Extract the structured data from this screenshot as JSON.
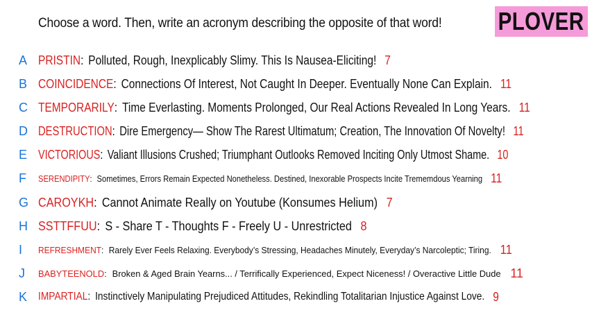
{
  "instruction": "Choose a word. Then, write an acronym describing the opposite of that word!",
  "logo": "PLOVER",
  "colors": {
    "letter": "#1a73d9",
    "word": "#d92121",
    "logo_bg": "#f59bd9"
  },
  "rows": [
    {
      "letter": "A",
      "word": "PRISTIN",
      "text": "Polluted, Rough, Inexplicably Slimy. This Is Nausea-Eliciting!",
      "count": "7"
    },
    {
      "letter": "B",
      "word": "COINCIDENCE",
      "text": "Connections Of Interest, Not Caught In Deeper. Eventually None Can Explain.",
      "count": "11"
    },
    {
      "letter": "C",
      "word": "TEMPORARILY",
      "text": "Time Everlasting. Moments Prolonged, Our Real Actions Revealed In Long Years.",
      "count": "11"
    },
    {
      "letter": "D",
      "word": "DESTRUCTION",
      "text": "Dire Emergency— Show The Rarest Ultimatum; Creation, The Innovation Of Novelty!",
      "count": "11"
    },
    {
      "letter": "E",
      "word": "VICTORIOUS",
      "text": "Valiant Illusions Crushed; Triumphant Outlooks Removed Inciting Only Utmost Shame.",
      "count": "10"
    },
    {
      "letter": "F",
      "word": "SERENDIPITY",
      "text": "Sometimes, Errors Remain Expected Nonetheless. Destined, Inexorable Prospects Incite Trememdous Yearning",
      "count": "11"
    },
    {
      "letter": "G",
      "word": "CAROYKH",
      "text": "Cannot Animate Really on Youtube (Konsumes Helium)",
      "count": "7"
    },
    {
      "letter": "H",
      "word": "SSTTFFUU",
      "text": "S - Share T - Thoughts F - Freely U - Unrestricted",
      "count": "8"
    },
    {
      "letter": "I",
      "word": "REFRESHMENT",
      "text": "Rarely Ever Feels Relaxing. Everybody’s Stressing, Headaches Minutely, Everyday’s Narcoleptic; Tiring.",
      "count": "11"
    },
    {
      "letter": "J",
      "word": "BABYTEENOLD",
      "text": "Broken & Aged Brain Yearns... / Terrifically Experienced, Expect Niceness! / Overactive Little Dude",
      "count": "11"
    },
    {
      "letter": "K",
      "word": "IMPARTIAL",
      "text": "Instinctively Manipulating Prejudiced Attitudes, Rekindling Totalitarian Injustice Against Love.",
      "count": "9"
    }
  ]
}
